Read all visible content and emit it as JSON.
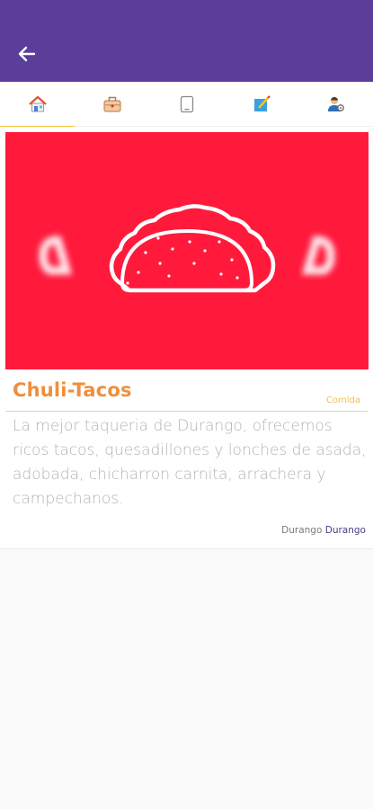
{
  "colors": {
    "appbar": "#5a3e99",
    "tab_indicator": "#f4c430",
    "hero_bg": "#ff1a3c",
    "title": "#ef8f3c",
    "category": "#f0c050",
    "description": "#b3b3b3",
    "location_state": "#4a3a8a"
  },
  "appbar": {
    "back_icon": "arrow-left-icon"
  },
  "tabs": [
    {
      "icon": "home-icon",
      "active": true
    },
    {
      "icon": "briefcase-icon",
      "active": false
    },
    {
      "icon": "document-icon",
      "active": false
    },
    {
      "icon": "edit-note-icon",
      "active": false
    },
    {
      "icon": "user-settings-icon",
      "active": false
    }
  ],
  "business": {
    "image_icon": "taco-icon",
    "name": "Chuli-Tacos",
    "category": "Comida",
    "description": "La mejor taqueria de Durango, ofrecemos ricos tacos, quesadillones y lonches de asada, adobada, chicharron carnita, arrachera y campechanos.",
    "location": {
      "city": "Durango",
      "state": "Durango"
    }
  }
}
